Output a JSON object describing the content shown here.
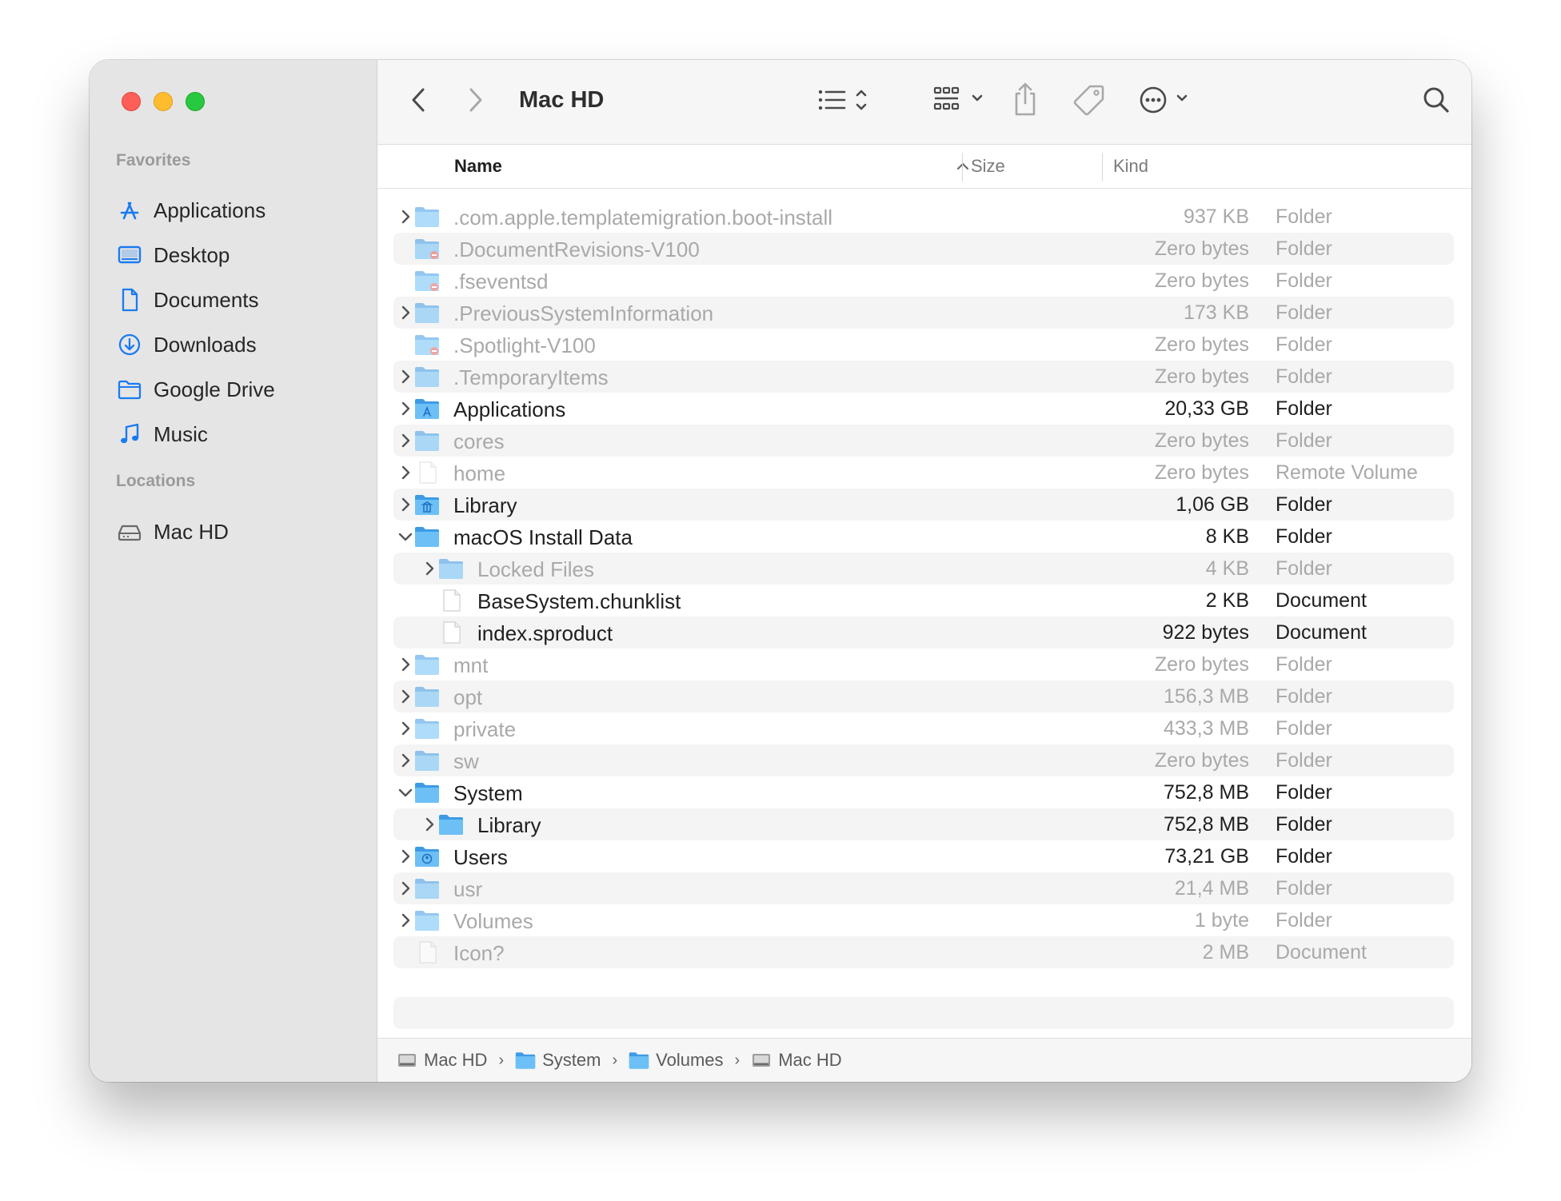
{
  "window": {
    "title": "Mac HD"
  },
  "sidebar": {
    "favorites_label": "Favorites",
    "locations_label": "Locations",
    "favorites": [
      {
        "label": "Applications",
        "icon": "applications-icon"
      },
      {
        "label": "Desktop",
        "icon": "desktop-icon"
      },
      {
        "label": "Documents",
        "icon": "documents-icon"
      },
      {
        "label": "Downloads",
        "icon": "downloads-icon"
      },
      {
        "label": "Google Drive",
        "icon": "folder-icon"
      },
      {
        "label": "Music",
        "icon": "music-icon"
      }
    ],
    "locations": [
      {
        "label": "Mac HD",
        "icon": "drive-icon"
      }
    ]
  },
  "columns": {
    "name": "Name",
    "size": "Size",
    "kind": "Kind"
  },
  "rows": [
    {
      "name": ".com.apple.templatemigration.boot-install",
      "size": "937 KB",
      "kind": "Folder"
    },
    {
      "name": ".DocumentRevisions-V100",
      "size": "Zero bytes",
      "kind": "Folder"
    },
    {
      "name": ".fseventsd",
      "size": "Zero bytes",
      "kind": "Folder"
    },
    {
      "name": ".PreviousSystemInformation",
      "size": "173 KB",
      "kind": "Folder"
    },
    {
      "name": ".Spotlight-V100",
      "size": "Zero bytes",
      "kind": "Folder"
    },
    {
      "name": ".TemporaryItems",
      "size": "Zero bytes",
      "kind": "Folder"
    },
    {
      "name": "Applications",
      "size": "20,33 GB",
      "kind": "Folder"
    },
    {
      "name": "cores",
      "size": "Zero bytes",
      "kind": "Folder"
    },
    {
      "name": "home",
      "size": "Zero bytes",
      "kind": "Remote Volume"
    },
    {
      "name": "Library",
      "size": "1,06 GB",
      "kind": "Folder"
    },
    {
      "name": "macOS Install Data",
      "size": "8 KB",
      "kind": "Folder"
    },
    {
      "name": "Locked Files",
      "size": "4 KB",
      "kind": "Folder"
    },
    {
      "name": "BaseSystem.chunklist",
      "size": "2 KB",
      "kind": "Document"
    },
    {
      "name": "index.sproduct",
      "size": "922 bytes",
      "kind": "Document"
    },
    {
      "name": "mnt",
      "size": "Zero bytes",
      "kind": "Folder"
    },
    {
      "name": "opt",
      "size": "156,3 MB",
      "kind": "Folder"
    },
    {
      "name": "private",
      "size": "433,3 MB",
      "kind": "Folder"
    },
    {
      "name": "sw",
      "size": "Zero bytes",
      "kind": "Folder"
    },
    {
      "name": "System",
      "size": "752,8 MB",
      "kind": "Folder"
    },
    {
      "name": "Library",
      "size": "752,8 MB",
      "kind": "Folder"
    },
    {
      "name": "Users",
      "size": "73,21 GB",
      "kind": "Folder"
    },
    {
      "name": "usr",
      "size": "21,4 MB",
      "kind": "Folder"
    },
    {
      "name": "Volumes",
      "size": "1 byte",
      "kind": "Folder"
    },
    {
      "name": "Icon?",
      "size": "2 MB",
      "kind": "Document"
    }
  ],
  "path_bar": [
    "Mac HD",
    "System",
    "Volumes",
    "Mac HD"
  ],
  "colors": {
    "accent": "#1a7bf0",
    "folder": "#5bb3ef",
    "dim_text": "#a9a9a9"
  }
}
